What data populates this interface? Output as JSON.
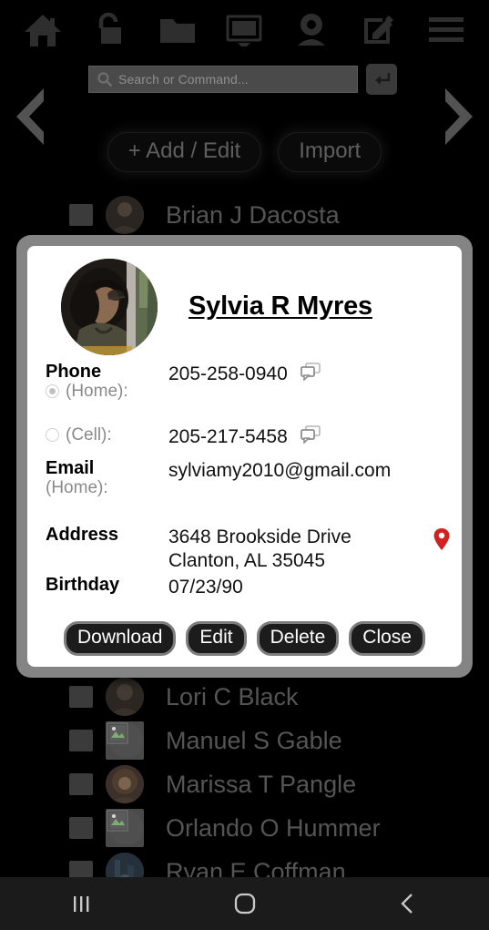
{
  "toolbar": {
    "icons": [
      {
        "name": "home-icon",
        "label": "Home"
      },
      {
        "name": "unlock-icon",
        "label": "Unlock"
      },
      {
        "name": "folder-icon",
        "label": "Folder"
      },
      {
        "name": "monitor-icon",
        "label": "Monitor"
      },
      {
        "name": "webcam-icon",
        "label": "Webcam"
      },
      {
        "name": "edit-square-icon",
        "label": "Edit"
      },
      {
        "name": "hamburger-menu-icon",
        "label": "Menu"
      }
    ]
  },
  "search": {
    "placeholder": "Search or Command...",
    "value": "",
    "icon": "search-icon",
    "submit_icon": "enter-key-icon"
  },
  "nav": {
    "prev_icon": "chevron-left-icon",
    "next_icon": "chevron-right-icon"
  },
  "actions": {
    "add_edit_label": "+ Add / Edit",
    "import_label": "Import"
  },
  "contact_list": [
    {
      "name": "Brian J Dacosta",
      "avatar": "photo"
    },
    {
      "name": "Lori C Black",
      "avatar": "photo"
    },
    {
      "name": "Manuel S Gable",
      "avatar": "broken"
    },
    {
      "name": "Marissa T Pangle",
      "avatar": "photo"
    },
    {
      "name": "Orlando O Hummer",
      "avatar": "broken"
    },
    {
      "name": "Ryan E Coffman",
      "avatar": "photo"
    }
  ],
  "dialog": {
    "contact_name": "Sylvia R Myres",
    "avatar_alt": "Contact photo",
    "phone": {
      "title": "Phone",
      "home_label": "(Home):",
      "home_value": "205-258-0940",
      "home_selected": true,
      "cell_label": "(Cell):",
      "cell_value": "205-217-5458",
      "cell_selected": false,
      "message_icon": "message-bubbles-icon"
    },
    "email": {
      "title": "Email",
      "sub_label": "(Home):",
      "value": "sylviamy2010@gmail.com"
    },
    "address": {
      "title": "Address",
      "value": "3648 Brookside Drive\nClanton, AL 35045",
      "map_icon": "map-pin-icon",
      "map_icon_color": "#d32020"
    },
    "birthday": {
      "title": "Birthday",
      "value": "07/23/90"
    },
    "buttons": [
      {
        "name": "download-button",
        "label": "Download"
      },
      {
        "name": "edit-button",
        "label": "Edit"
      },
      {
        "name": "delete-button",
        "label": "Delete"
      },
      {
        "name": "close-button",
        "label": "Close"
      }
    ]
  },
  "system_nav": {
    "recents_icon": "recents-icon",
    "home_icon": "home-square-icon",
    "back_icon": "back-chevron-icon"
  },
  "colors": {
    "page_background": "#000000",
    "toolbar_icon": "#2e2e2e",
    "dialog_border": "#848484",
    "dialog_background": "#ffffff",
    "accent_red": "#d32020",
    "navbar": "#1b1b1b"
  }
}
